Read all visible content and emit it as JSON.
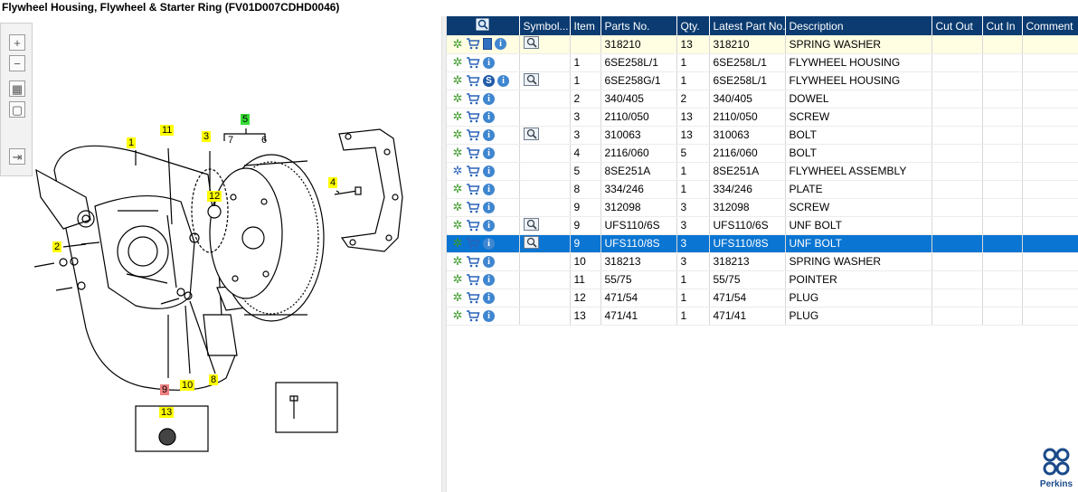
{
  "window": {
    "title": "Flywheel Housing, Flywheel & Starter Ring (FV01D007CDHD0046)"
  },
  "toolbar": {
    "buttons": [
      {
        "icon": "zoom-in-icon",
        "glyph": "+"
      },
      {
        "icon": "zoom-out-icon",
        "glyph": "−"
      },
      {
        "icon": "fit-page-icon",
        "glyph": "▦"
      },
      {
        "icon": "actual-size-icon",
        "glyph": "▢"
      },
      {
        "icon": "export-icon",
        "glyph": "⇥"
      }
    ]
  },
  "diagram": {
    "callouts": [
      "1",
      "11",
      "3",
      "5",
      "7",
      "6",
      "12",
      "4",
      "2",
      "9",
      "10",
      "8",
      "13"
    ]
  },
  "grid": {
    "columns": [
      "",
      "Symbol...",
      "Item",
      "Parts No.",
      "Qty.",
      "Latest Part No.",
      "Description",
      "Cut Out",
      "Cut In",
      "Comment"
    ],
    "rows": [
      {
        "gear": "green",
        "doc": true,
        "service": false,
        "symbol": true,
        "item": "",
        "parts_no": "318210",
        "qty": "13",
        "latest": "318210",
        "desc": "SPRING WASHER",
        "state": "first"
      },
      {
        "gear": "green",
        "doc": false,
        "service": false,
        "symbol": false,
        "item": "1",
        "parts_no": "6SE258L/1",
        "qty": "1",
        "latest": "6SE258L/1",
        "desc": "FLYWHEEL HOUSING",
        "state": ""
      },
      {
        "gear": "green",
        "doc": false,
        "service": true,
        "symbol": true,
        "item": "1",
        "parts_no": "6SE258G/1",
        "qty": "1",
        "latest": "6SE258L/1",
        "desc": "FLYWHEEL HOUSING",
        "state": ""
      },
      {
        "gear": "green",
        "doc": false,
        "service": false,
        "symbol": false,
        "item": "2",
        "parts_no": "340/405",
        "qty": "2",
        "latest": "340/405",
        "desc": "DOWEL",
        "state": ""
      },
      {
        "gear": "green",
        "doc": false,
        "service": false,
        "symbol": false,
        "item": "3",
        "parts_no": "2110/050",
        "qty": "13",
        "latest": "2110/050",
        "desc": "SCREW",
        "state": ""
      },
      {
        "gear": "green",
        "doc": false,
        "service": false,
        "symbol": true,
        "item": "3",
        "parts_no": "310063",
        "qty": "13",
        "latest": "310063",
        "desc": "BOLT",
        "state": ""
      },
      {
        "gear": "green",
        "doc": false,
        "service": false,
        "symbol": false,
        "item": "4",
        "parts_no": "2116/060",
        "qty": "5",
        "latest": "2116/060",
        "desc": "BOLT",
        "state": ""
      },
      {
        "gear": "blue",
        "doc": false,
        "service": false,
        "symbol": false,
        "item": "5",
        "parts_no": "8SE251A",
        "qty": "1",
        "latest": "8SE251A",
        "desc": "FLYWHEEL ASSEMBLY",
        "state": ""
      },
      {
        "gear": "green",
        "doc": false,
        "service": false,
        "symbol": false,
        "item": "8",
        "parts_no": "334/246",
        "qty": "1",
        "latest": "334/246",
        "desc": "PLATE",
        "state": ""
      },
      {
        "gear": "green",
        "doc": false,
        "service": false,
        "symbol": false,
        "item": "9",
        "parts_no": "312098",
        "qty": "3",
        "latest": "312098",
        "desc": "SCREW",
        "state": ""
      },
      {
        "gear": "green",
        "doc": false,
        "service": false,
        "symbol": true,
        "item": "9",
        "parts_no": "UFS110/6S",
        "qty": "3",
        "latest": "UFS110/6S",
        "desc": "UNF BOLT",
        "state": ""
      },
      {
        "gear": "green",
        "doc": false,
        "service": false,
        "symbol": true,
        "item": "9",
        "parts_no": "UFS110/8S",
        "qty": "3",
        "latest": "UFS110/8S",
        "desc": "UNF BOLT",
        "state": "selected"
      },
      {
        "gear": "green",
        "doc": false,
        "service": false,
        "symbol": false,
        "item": "10",
        "parts_no": "318213",
        "qty": "3",
        "latest": "318213",
        "desc": "SPRING WASHER",
        "state": ""
      },
      {
        "gear": "green",
        "doc": false,
        "service": false,
        "symbol": false,
        "item": "11",
        "parts_no": "55/75",
        "qty": "1",
        "latest": "55/75",
        "desc": "POINTER",
        "state": ""
      },
      {
        "gear": "green",
        "doc": false,
        "service": false,
        "symbol": false,
        "item": "12",
        "parts_no": "471/54",
        "qty": "1",
        "latest": "471/54",
        "desc": "PLUG",
        "state": ""
      },
      {
        "gear": "green",
        "doc": false,
        "service": false,
        "symbol": false,
        "item": "13",
        "parts_no": "471/41",
        "qty": "1",
        "latest": "471/41",
        "desc": "PLUG",
        "state": ""
      }
    ]
  },
  "brand": {
    "logo_text": "Perkins",
    "colors": {
      "header": "#0b3b70",
      "selected": "#0a75d2",
      "callout": "#ffff00",
      "callout_group": "#33dd33",
      "callout_active": "#f08080"
    }
  }
}
